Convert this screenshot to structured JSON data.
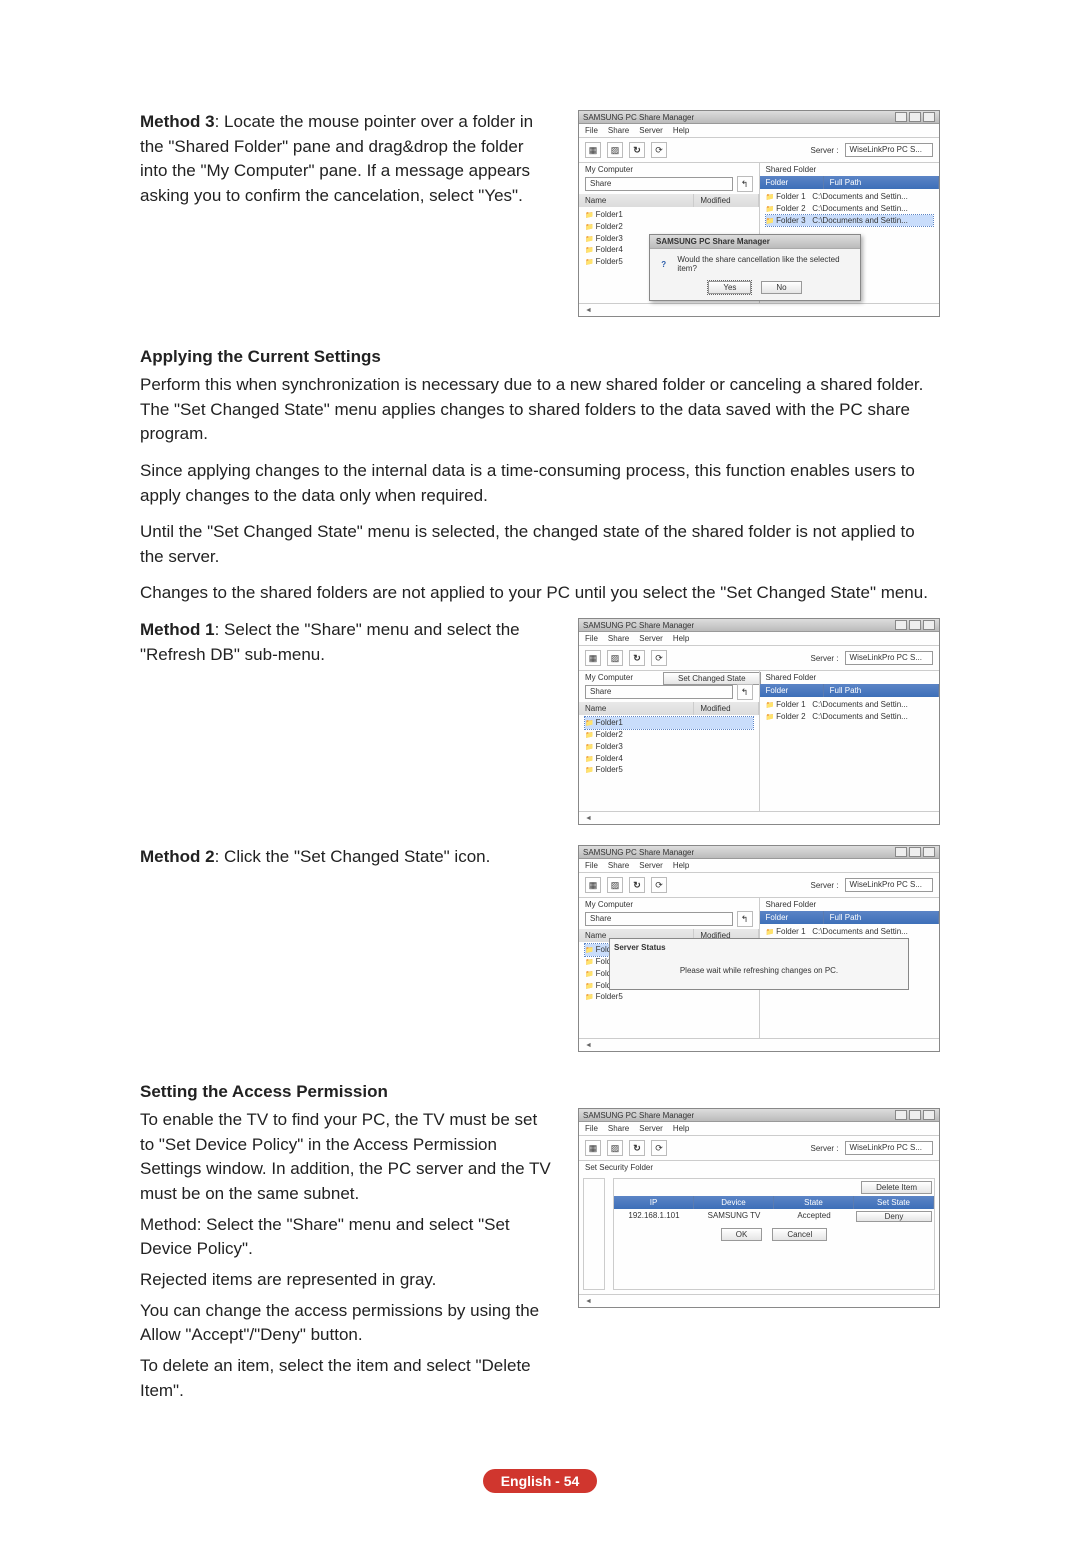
{
  "method3": {
    "label": "Method 3",
    "text": ": Locate the mouse pointer over a folder in the \"Shared Folder\" pane and drag&drop the folder into the \"My Computer\" pane. If a message appears asking you to confirm the cancelation, select \"Yes\"."
  },
  "applying": {
    "heading": "Applying the Current Settings",
    "p1": "Perform this when synchronization is necessary due to a new shared folder or canceling a shared folder. The \"Set Changed State\" menu applies changes to shared folders to the data saved with the PC share program.",
    "p2": "Since applying changes to the internal data is a time-consuming process, this function enables users to apply changes to the data only when required.",
    "p3": "Until the \"Set Changed State\" menu is selected, the changed state of the shared folder is not applied to the server.",
    "p4": "Changes to the shared folders are not applied to your PC until you select the \"Set Changed State\" menu.",
    "m1_label": "Method 1",
    "m1_text": ": Select the \"Share\" menu and select the \"Refresh DB\" sub-menu.",
    "m2_label": "Method 2",
    "m2_text": ": Click the \"Set Changed State\" icon."
  },
  "access": {
    "heading": "Setting the Access Permission",
    "p1": "To enable the TV to find your PC, the TV must be set to \"Set Device Policy\" in the Access Permission Settings window. In addition, the PC server and the TV must be on the same subnet.",
    "p2": "Method: Select the \"Share\" menu and select \"Set Device Policy\".",
    "p3": "Rejected items are represented in gray.",
    "p4": "You can change the access permissions by using the Allow \"Accept\"/\"Deny\" button.",
    "p5": "To delete an item, select the item and select \"Delete Item\"."
  },
  "win": {
    "title": "SAMSUNG PC Share Manager",
    "menus": [
      "File",
      "Share",
      "Server",
      "Help"
    ],
    "server_lbl": "Server :",
    "server_val": "WiseLinkPro PC S...",
    "left_label": "My Computer",
    "right_label": "Shared Folder",
    "drive": "Share",
    "col_name": "Name",
    "col_modified": "Modified",
    "col_folder": "Folder",
    "col_fullpath": "Full Path",
    "folders": [
      "Folder1",
      "Folder2",
      "Folder3",
      "Folder4",
      "Folder5"
    ],
    "shared_rows": [
      {
        "f": "Folder 1",
        "p": "C:\\Documents and Settin..."
      },
      {
        "f": "Folder 2",
        "p": "C:\\Documents and Settin..."
      },
      {
        "f": "Folder 3",
        "p": "C:\\Documents and Settin..."
      }
    ],
    "set_changed": "Set Changed State",
    "status_msg": "Please wait while refreshing changes on PC.",
    "status_title": "Server Status"
  },
  "dialog": {
    "title": "SAMSUNG PC Share Manager",
    "msg": "Would the share cancellation like the selected item?",
    "yes": "Yes",
    "no": "No"
  },
  "policy": {
    "ip": "IP",
    "device": "Device",
    "state": "State",
    "set_state": "Set State",
    "ip_val": "192.168.1.101",
    "device_val": "SAMSUNG TV",
    "state_val": "Accepted",
    "deny": "Deny",
    "delete": "Delete Item",
    "ok": "OK",
    "cancel": "Cancel",
    "set_security": "Set Security Folder"
  },
  "footer": {
    "lang": "English - 54"
  }
}
